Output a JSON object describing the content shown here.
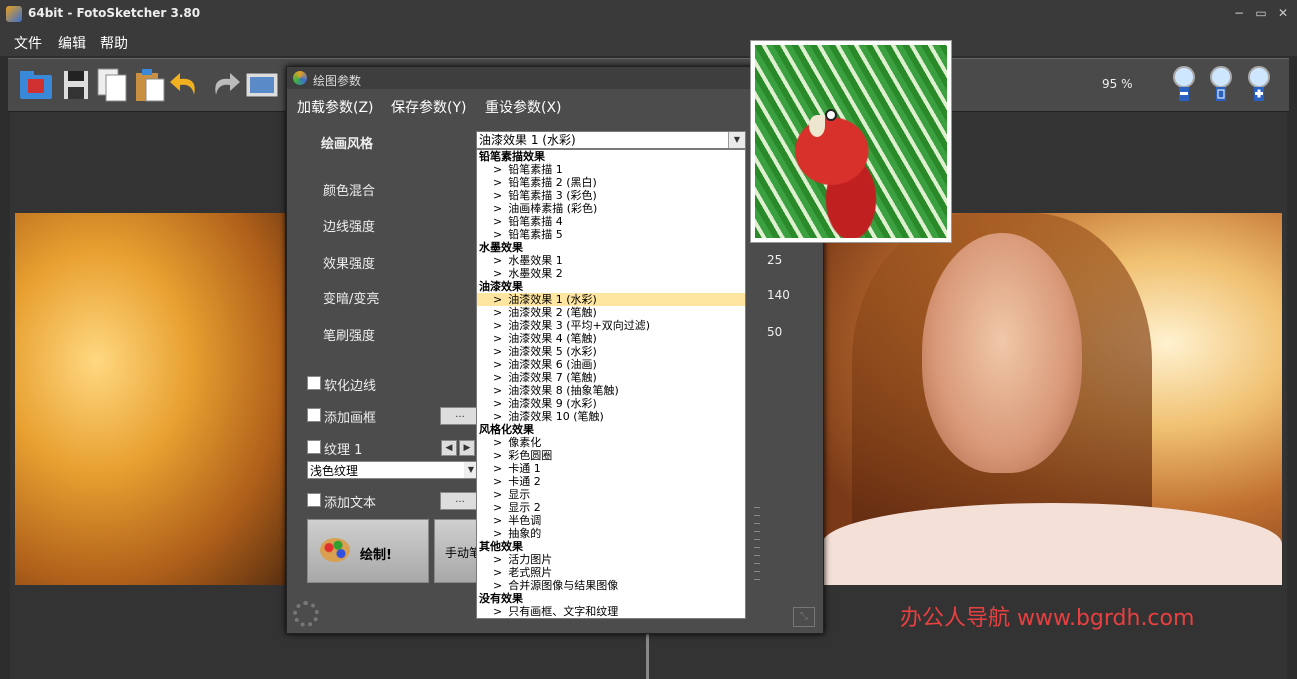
{
  "window": {
    "title": "64bit - FotoSketcher 3.80",
    "min": "−",
    "max": "▭",
    "close": "✕"
  },
  "menu": [
    "文件",
    "编辑",
    "帮助"
  ],
  "toolbar": {
    "zoom": "95 %"
  },
  "dialog": {
    "title": "绘图参数",
    "menu": [
      "加载参数(Z)",
      "保存参数(Y)",
      "重设参数(X)"
    ],
    "style_label": "绘画风格",
    "style_value": "油漆效果 1 (水彩)",
    "params": [
      {
        "label": "颜色混合",
        "value": ""
      },
      {
        "label": "边线强度",
        "value": ""
      },
      {
        "label": "效果强度",
        "value": "25"
      },
      {
        "label": "变暗/变亮",
        "value": "140"
      },
      {
        "label": "笔刷强度",
        "value": "50"
      }
    ],
    "soften": "软化边线",
    "add_frame": "添加画框",
    "texture": "纹理 1",
    "texture_value": "浅色纹理",
    "add_text": "添加文本",
    "dots": "...",
    "draw": "绘制!",
    "manual": "手动笔"
  },
  "dropdown": {
    "groups": [
      {
        "name": "铅笔素描效果",
        "items": [
          "铅笔素描 1",
          "铅笔素描 2 (黑白)",
          "铅笔素描 3 (彩色)",
          "油画棒素描 (彩色)",
          "铅笔素描 4",
          "铅笔素描 5"
        ]
      },
      {
        "name": "水墨效果",
        "items": [
          "水墨效果 1",
          "水墨效果 2"
        ]
      },
      {
        "name": "油漆效果",
        "items": [
          "油漆效果 1 (水彩)",
          "油漆效果 2 (笔触)",
          "油漆效果 3 (平均+双向过滤)",
          "油漆效果 4 (笔触)",
          "油漆效果 5 (水彩)",
          "油漆效果 6 (油画)",
          "油漆效果 7 (笔触)",
          "油漆效果 8 (抽象笔触)",
          "油漆效果 9 (水彩)",
          "油漆效果 10 (笔触)"
        ]
      },
      {
        "name": "风格化效果",
        "items": [
          "像素化",
          "彩色圆圈",
          "卡通 1",
          "卡通 2",
          "显示",
          "显示 2",
          "半色调",
          "抽象的"
        ]
      },
      {
        "name": "其他效果",
        "items": [
          "活力图片",
          "老式照片",
          "合并源图像与结果图像"
        ]
      },
      {
        "name": "没有效果",
        "items": [
          "只有画框、文字和纹理"
        ]
      }
    ],
    "selected": "油漆效果 1 (水彩)"
  },
  "watermark": "办公人导航 www.bgrdh.com"
}
